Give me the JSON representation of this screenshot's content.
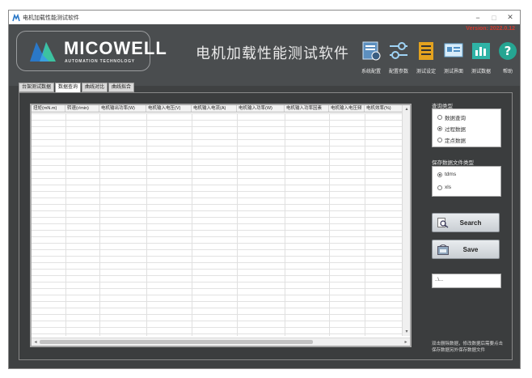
{
  "window": {
    "title": "电机加载性能测试软件",
    "controls": {
      "minimize": "−",
      "maximize": "□",
      "close": "✕"
    }
  },
  "header": {
    "version": "Version: 2022.0.12",
    "logo_name": "MICOWELL",
    "logo_sub": "AUTOMATION TECHNOLOGY",
    "app_title": "电机加载性能测试软件"
  },
  "toolbar": [
    {
      "label": "系统配置",
      "icon": "system-config-icon"
    },
    {
      "label": "配置参数",
      "icon": "config-params-icon"
    },
    {
      "label": "测试设定",
      "icon": "test-settings-icon"
    },
    {
      "label": "测试界面",
      "icon": "test-interface-icon"
    },
    {
      "label": "测试数据",
      "icon": "test-data-icon"
    },
    {
      "label": "帮助",
      "icon": "help-icon"
    }
  ],
  "tabs": [
    {
      "label": "台架测试数据",
      "active": false
    },
    {
      "label": "数据查询",
      "active": true
    },
    {
      "label": "曲线对比",
      "active": false
    },
    {
      "label": "曲线拟合",
      "active": false
    }
  ],
  "table": {
    "columns": [
      "扭矩(mN.m)",
      "转速(r/min)",
      "电机输出功率(W)",
      "电机输入电压(V)",
      "电机输入电流(A)",
      "电机输入功率(W)",
      "电机输入功率因素",
      "电机输入电压频",
      "电机效率(%)"
    ],
    "rows": []
  },
  "query_type": {
    "label": "查询类型",
    "options": [
      {
        "label": "数据查询",
        "selected": false
      },
      {
        "label": "过程数据",
        "selected": true
      },
      {
        "label": "定点数据",
        "selected": false
      }
    ]
  },
  "file_type": {
    "label": "保存数据文件类型",
    "options": [
      {
        "label": "tdms",
        "selected": true
      },
      {
        "label": "xls",
        "selected": false
      }
    ]
  },
  "buttons": {
    "search": "Search",
    "save": "Save"
  },
  "path_field": {
    "value": "..\\..."
  },
  "note": "双击删除数据，修改数据后需要点击保存数据另外保存数据文件",
  "colors": {
    "accent_blue": "#4fa3e0",
    "logo_blue": "#2a78c8",
    "logo_green": "#3cc2a0",
    "version_red": "#d03a2e"
  }
}
